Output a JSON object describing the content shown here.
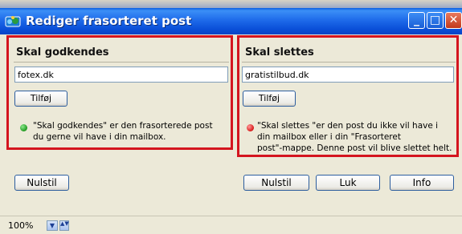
{
  "window": {
    "title": "Rediger frasorteret post",
    "min_glyph": "_",
    "max_glyph": "□",
    "close_glyph": "✕"
  },
  "approve_panel": {
    "heading": "Skal godkendes",
    "input_value": "fotex.dk",
    "add_label": "Tilføj",
    "status_color": "green",
    "description_lines": [
      "\"Skal godkendes\" er den frasorterede post",
      "du gerne vil have i din mailbox."
    ],
    "reset_label": "Nulstil"
  },
  "delete_panel": {
    "heading": "Skal slettes",
    "input_value": "gratistilbud.dk",
    "add_label": "Tilføj",
    "status_color": "red",
    "description_lines": [
      "\"Skal slettes \"er den post du ikke vil have i",
      "din mailbox eller i din \"Frasorteret",
      "post\"-mappe. Denne post vil blive slettet helt."
    ],
    "reset_label": "Nulstil",
    "close_label": "Luk",
    "info_label": "Info"
  },
  "statusbar": {
    "zoom": "100%",
    "dropdown_glyph": "▼",
    "spin_glyph": "▲▼"
  },
  "colors": {
    "highlight_border": "#d4151f",
    "titlebar": "#0a5ee0"
  }
}
